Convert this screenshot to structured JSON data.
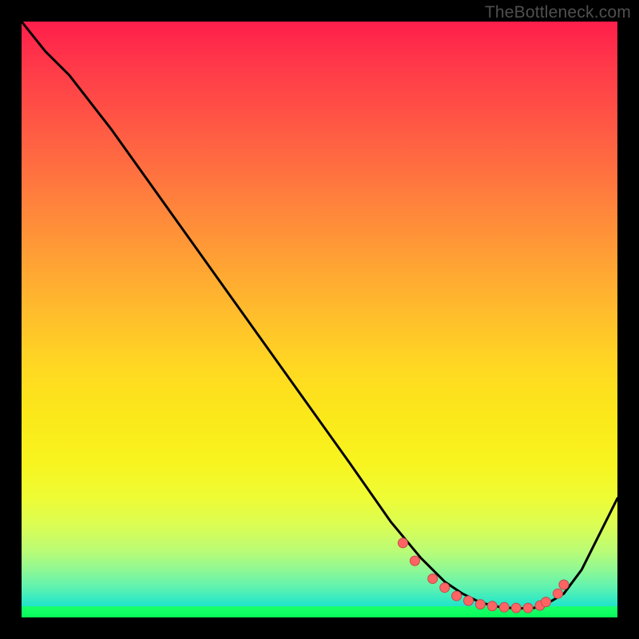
{
  "watermark": "TheBottleneck.com",
  "chart_data": {
    "type": "line",
    "title": "",
    "xlabel": "",
    "ylabel": "",
    "xlim": [
      0,
      100
    ],
    "ylim": [
      0,
      100
    ],
    "grid": false,
    "legend": false,
    "series": [
      {
        "name": "curve",
        "type": "line",
        "color": "#000000",
        "x": [
          0,
          4,
          8,
          15,
          25,
          35,
          45,
          55,
          62,
          67,
          71,
          74,
          77,
          80,
          83,
          86,
          88,
          91,
          94,
          97,
          100
        ],
        "values": [
          100,
          95,
          91,
          82,
          68,
          54,
          40,
          26,
          16,
          10,
          6,
          4,
          2.5,
          1.8,
          1.5,
          1.6,
          2.2,
          4,
          8,
          14,
          20
        ]
      },
      {
        "name": "markers",
        "type": "scatter",
        "color": "#ff6464",
        "x": [
          64,
          66,
          69,
          71,
          73,
          75,
          77,
          79,
          81,
          83,
          85,
          87,
          88,
          90,
          91
        ],
        "values": [
          12.5,
          9.5,
          6.5,
          5,
          3.6,
          2.8,
          2.2,
          1.9,
          1.7,
          1.6,
          1.6,
          2.0,
          2.6,
          4.0,
          5.5
        ]
      }
    ]
  },
  "colors": {
    "background": "#000000",
    "watermark": "#4f4f4f",
    "line": "#000000",
    "marker_fill": "#ff6464",
    "marker_stroke": "#c24b4b"
  }
}
